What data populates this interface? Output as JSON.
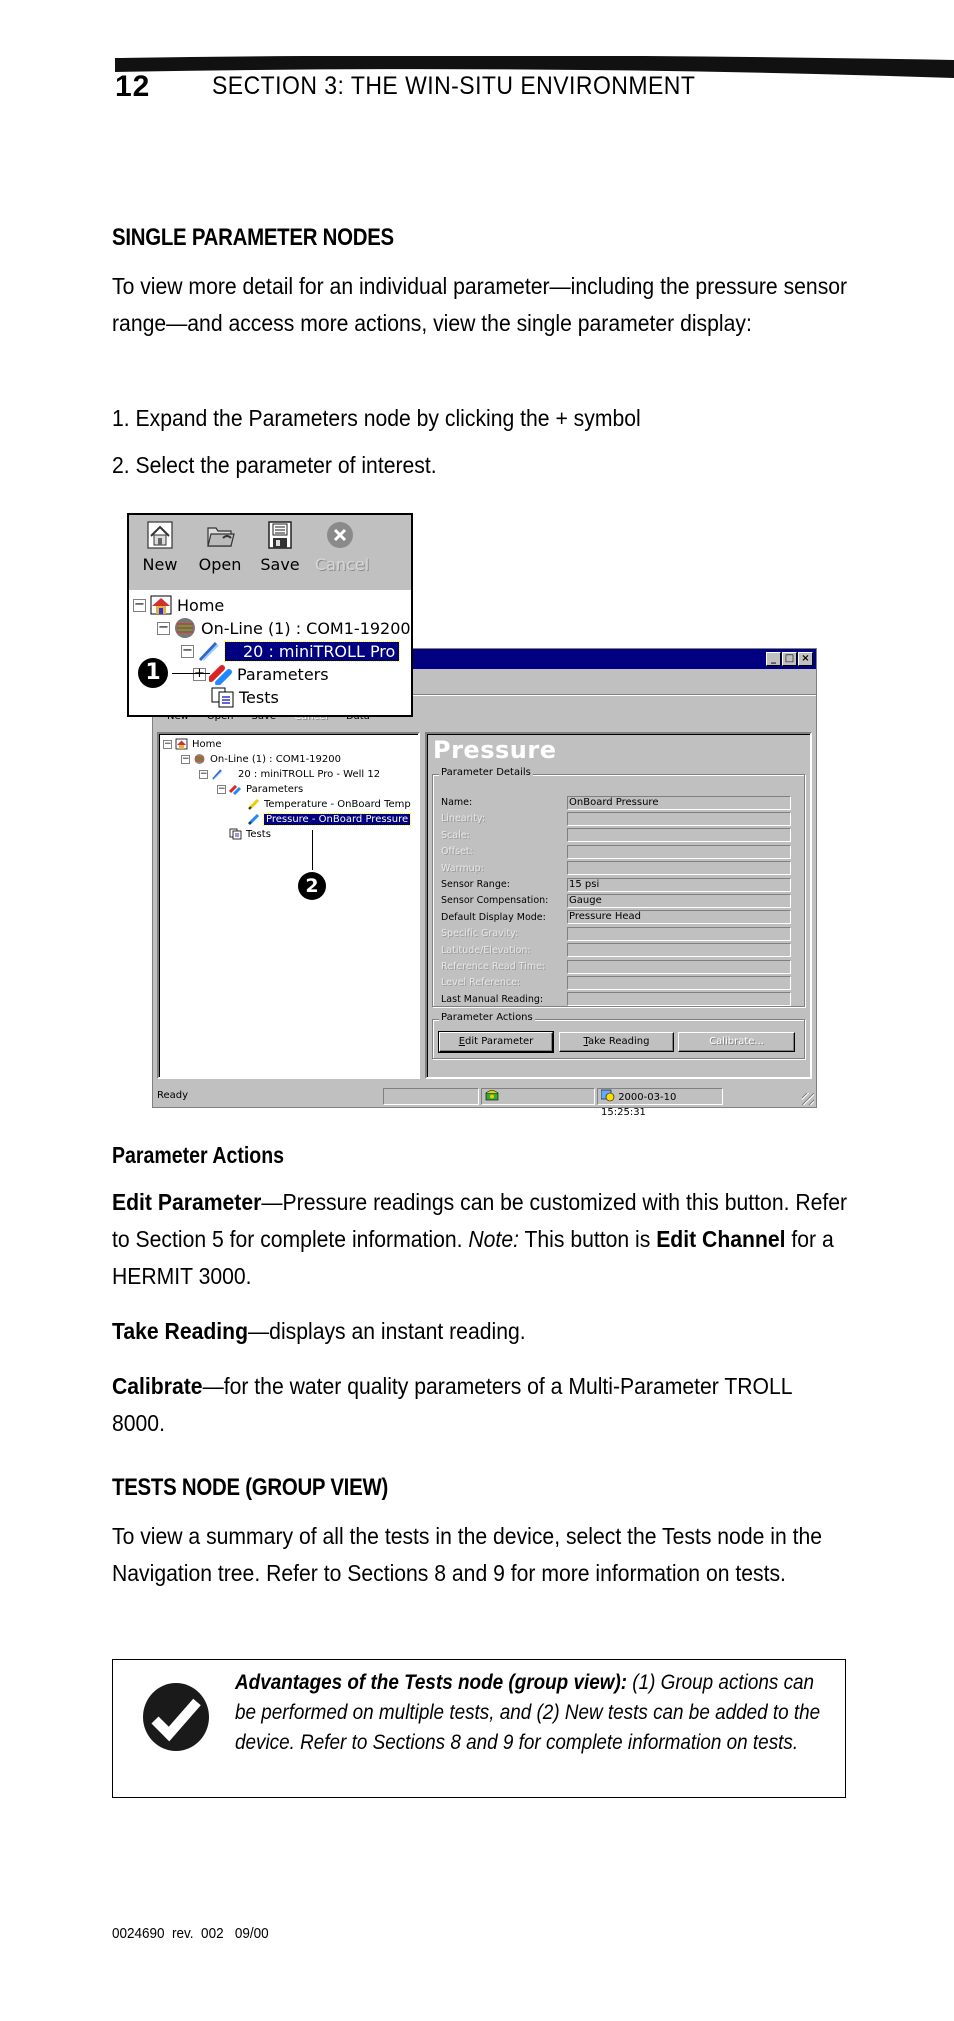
{
  "header": {
    "page_number": "12",
    "section_title": "SECTION 3: THE WIN-SITU ENVIRONMENT"
  },
  "section1": {
    "heading": "SINGLE PARAMETER NODES",
    "intro": "To view more detail for an individual parameter—including the pressure sensor range—and access more actions, view the single parameter display:",
    "steps": [
      "1.  Expand the Parameters node by clicking the + symbol",
      "2.  Select the parameter of interest."
    ]
  },
  "inset": {
    "toolbar": [
      {
        "label": "New",
        "icon": "new-home-icon",
        "enabled": true
      },
      {
        "label": "Open",
        "icon": "open-folder-icon",
        "enabled": true
      },
      {
        "label": "Save",
        "icon": "floppy-disk-icon",
        "enabled": true
      },
      {
        "label": "Cancel",
        "icon": "cancel-x-icon",
        "enabled": false
      }
    ],
    "tree": [
      {
        "label": "Home",
        "expander": "−",
        "icon": "home-icon"
      },
      {
        "label": "On-Line (1) : COM1-19200",
        "expander": "−",
        "icon": "cable-icon"
      },
      {
        "label": "20 : miniTROLL Pro",
        "expander": "−",
        "icon": "probe-icon",
        "selected": true
      },
      {
        "label": "Parameters",
        "expander": "+",
        "icon": "parameters-icon"
      },
      {
        "label": "Tests",
        "expander": "",
        "icon": "tests-icon"
      }
    ],
    "callout": "1"
  },
  "window": {
    "toolbar_labels": [
      "New",
      "Open",
      "Save",
      "Cancel",
      "Data"
    ],
    "tree": [
      {
        "label": "Home",
        "expander": "−"
      },
      {
        "label": "On-Line (1) : COM1-19200",
        "expander": "−"
      },
      {
        "label": "20 : miniTROLL Pro - Well 12",
        "expander": "−"
      },
      {
        "label": "Parameters",
        "expander": "−"
      },
      {
        "label": "Temperature - OnBoard Temp",
        "expander": ""
      },
      {
        "label": "Pressure - OnBoard Pressure",
        "expander": "",
        "selected": true
      },
      {
        "label": "Tests",
        "expander": ""
      }
    ],
    "callout": "2",
    "detail_title": "Pressure",
    "parameter_details_label": "Parameter Details",
    "properties": [
      {
        "label": "Name:",
        "value": "OnBoard Pressure",
        "enabled": true
      },
      {
        "label": "Linearity:",
        "value": "",
        "enabled": false
      },
      {
        "label": "Scale:",
        "value": "",
        "enabled": false
      },
      {
        "label": "Offset:",
        "value": "",
        "enabled": false
      },
      {
        "label": "Warmup:",
        "value": "",
        "enabled": false
      },
      {
        "label": "Sensor Range:",
        "value": "15 psi",
        "enabled": true
      },
      {
        "label": "Sensor Compensation:",
        "value": "Gauge",
        "enabled": true
      },
      {
        "label": "Default Display Mode:",
        "value": "Pressure Head",
        "enabled": true
      },
      {
        "label": "Specific Gravity:",
        "value": "",
        "enabled": false
      },
      {
        "label": "Latitude/Elevation:",
        "value": "",
        "enabled": false
      },
      {
        "label": "Reference Read Time:",
        "value": "",
        "enabled": false
      },
      {
        "label": "Level Reference:",
        "value": "",
        "enabled": false
      },
      {
        "label": "Last Manual Reading:",
        "value": "",
        "enabled": true
      }
    ],
    "parameter_actions_label": "Parameter Actions",
    "buttons": {
      "edit_parameter_key": "E",
      "edit_parameter_rest": "dit Parameter",
      "take_reading_key": "T",
      "take_reading_rest": "ake Reading",
      "calibrate": "Calibrate..."
    },
    "status": {
      "text": "Ready",
      "datetime": "2000-03-10  15:25:31"
    }
  },
  "section2": {
    "heading": "Parameter Actions",
    "edit_term": "Edit Parameter",
    "edit_desc": "—Pressure readings can be customized with this button. Refer to Section 5 for complete information. ",
    "edit_note": "Note:",
    "edit_note_text": " This button is ",
    "edit_note_term": "Edit Channel",
    "edit_note_tail": " for a HERMIT 3000.",
    "take_term": "Take Reading",
    "take_desc": "—displays an instant reading.",
    "cal_term": "Calibrate",
    "cal_desc": "—for the water quality parameters of a Multi-Parameter TROLL 8000."
  },
  "section3": {
    "heading": "TESTS NODE (GROUP VIEW)",
    "text": "To view a summary of all the tests in the device, select the Tests node in the Navigation tree. Refer to Sections 8 and 9 for more information on tests."
  },
  "note": {
    "icon": "checkmark-icon",
    "bold": "Advantages of the Tests node (group view):",
    "text": " (1) Group actions can be performed on multiple tests, and (2) New tests can be added to the device. Refer to Sections 8 and 9 for complete information on tests."
  },
  "footer": {
    "text": "0024690  rev.  002   09/00"
  }
}
